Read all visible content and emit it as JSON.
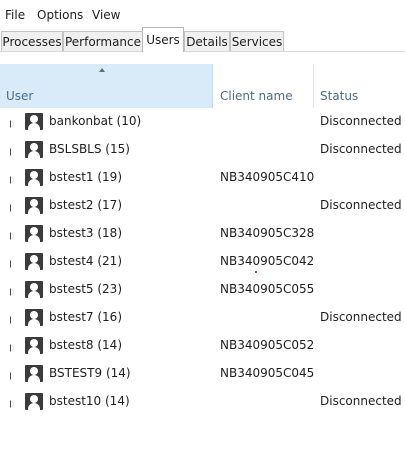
{
  "menu": [
    "File",
    "Options",
    "View"
  ],
  "tabs": [
    {
      "label": "Processes",
      "active": false
    },
    {
      "label": "Performance",
      "active": false
    },
    {
      "label": "Users",
      "active": true
    },
    {
      "label": "Details",
      "active": false
    },
    {
      "label": "Services",
      "active": false
    }
  ],
  "columns": {
    "user": "User",
    "client": "Client name",
    "status": "Status",
    "sorted": "user"
  },
  "rows": [
    {
      "user": "bankonbat (10)",
      "client": "",
      "status": "Disconnected"
    },
    {
      "user": "BSLSBLS (15)",
      "client": "",
      "status": "Disconnected"
    },
    {
      "user": "bstest1 (19)",
      "client": "NB340905C410",
      "status": ""
    },
    {
      "user": "bstest2 (17)",
      "client": "",
      "status": "Disconnected"
    },
    {
      "user": "bstest3 (18)",
      "client": "NB340905C328",
      "status": ""
    },
    {
      "user": "bstest4 (21)",
      "client": "NB340905C042",
      "status": ""
    },
    {
      "user": "bstest5 (23)",
      "client": "NB340905C055",
      "status": ""
    },
    {
      "user": "bstest7 (16)",
      "client": "",
      "status": "Disconnected"
    },
    {
      "user": "bstest8 (14)",
      "client": "NB340905C052",
      "status": ""
    },
    {
      "user": "BSTEST9 (14)",
      "client": "NB340905C045",
      "status": ""
    },
    {
      "user": "bstest10 (14)",
      "client": "",
      "status": "Disconnected"
    }
  ],
  "colors": {
    "header_highlight": "#d9ebf9",
    "header_text": "#4c6b8a"
  }
}
